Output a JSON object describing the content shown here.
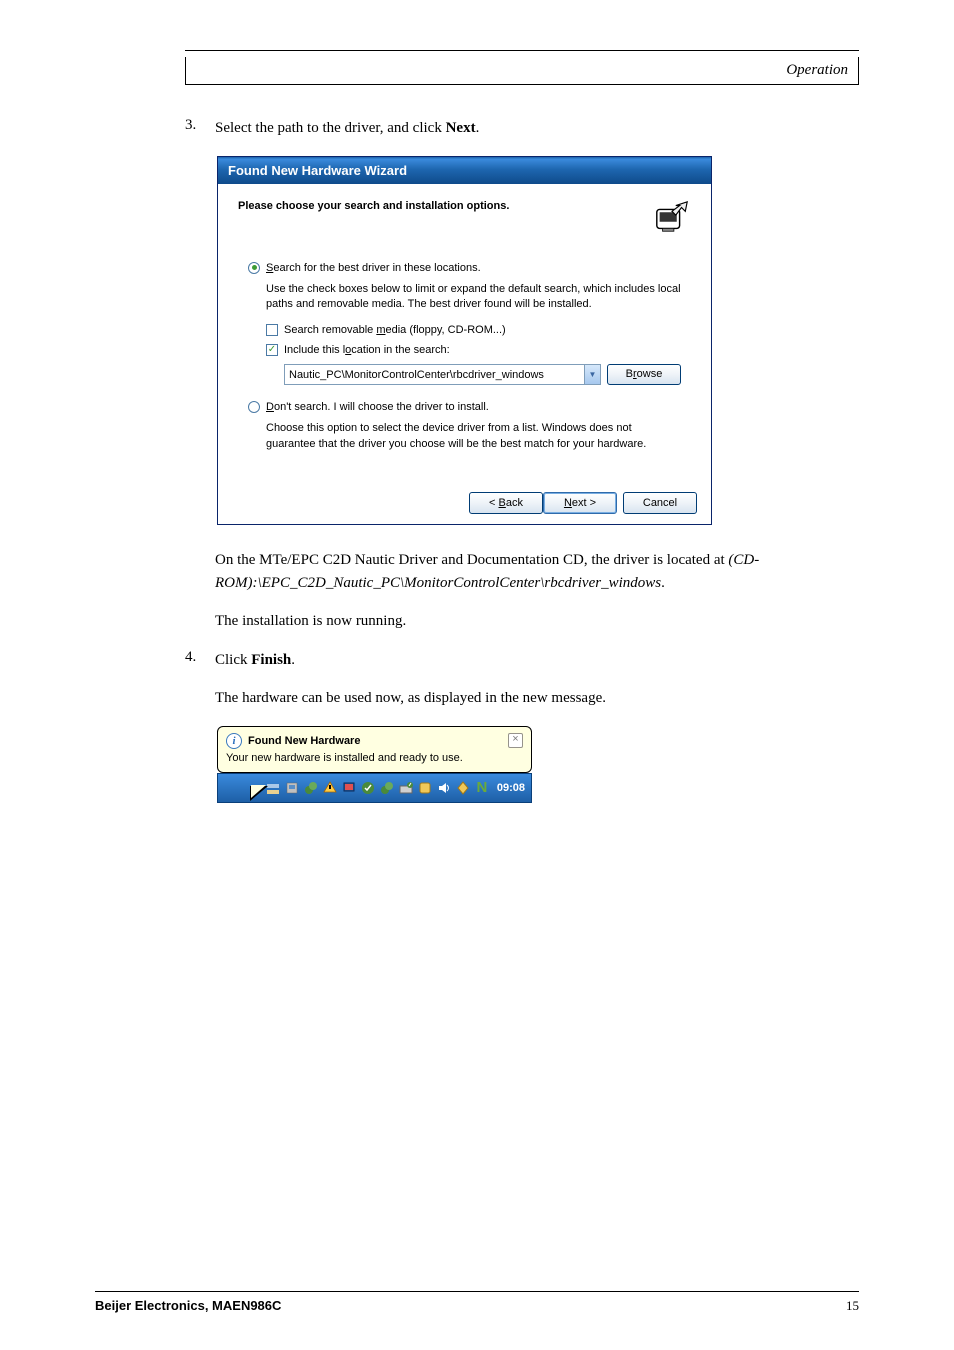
{
  "header": {
    "section": "Operation"
  },
  "steps": {
    "s3": {
      "num": "3.",
      "text_a": "Select the path to the driver, and click ",
      "text_b": "Next",
      "text_c": "."
    },
    "para1_a": "On the MTe/EPC C2D Nautic Driver and Documentation CD, the driver is located at ",
    "para1_b": "(CD-ROM):\\EPC_C2D_Nautic_PC\\MonitorControlCenter\\rbcdriver_windows",
    "para1_c": ".",
    "para2": "The installation is now running.",
    "s4": {
      "num": "4.",
      "text_a": "Click ",
      "text_b": "Finish",
      "text_c": "."
    },
    "para3": "The hardware can be used now, as displayed in the new message."
  },
  "wizard": {
    "title": "Found New Hardware Wizard",
    "header": "Please choose your search and installation options.",
    "radio1_a": "S",
    "radio1_b": "earch for the best driver in these locations.",
    "help1": "Use the check boxes below to limit or expand the default search, which includes local paths and removable media. The best driver found will be installed.",
    "cb1_a": "Search removable ",
    "cb1_b": "m",
    "cb1_c": "edia (floppy, CD-ROM...)",
    "cb2_a": "Include this l",
    "cb2_b": "o",
    "cb2_c": "cation in the search:",
    "combo": "Nautic_PC\\MonitorControlCenter\\rbcdriver_windows",
    "browse_a": "B",
    "browse_b": "r",
    "browse_c": "owse",
    "radio2_a": "D",
    "radio2_b": "on't search. I will choose the driver to install.",
    "help2": "Choose this option to select the device driver from a list.  Windows does not guarantee that the driver you choose will be the best match for your hardware.",
    "back_a": "< ",
    "back_b": "B",
    "back_c": "ack",
    "next_a": "N",
    "next_b": "ext >",
    "cancel": "Cancel"
  },
  "balloon": {
    "title": "Found New Hardware",
    "body": "Your new hardware is installed and ready to use.",
    "clock": "09:08",
    "n": "N"
  },
  "footer": {
    "left": "Beijer Electronics,  MAEN986C",
    "right": "15"
  }
}
